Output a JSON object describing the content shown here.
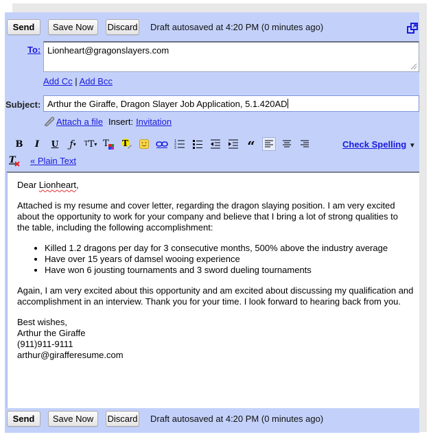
{
  "top_bar": {
    "send_label": "Send",
    "save_label": "Save Now",
    "discard_label": "Discard",
    "autosave_status": "Draft autosaved at 4:20 PM (0 minutes ago)",
    "popout_icon": "popout-window-icon"
  },
  "to": {
    "label": "To:",
    "value": "Lionheart@gragonslayers.com"
  },
  "cc_links": {
    "add_cc": "Add Cc",
    "separator": "|",
    "add_bcc": "Add Bcc"
  },
  "subject": {
    "label": "Subject:",
    "value": "Arthur the Giraffe, Dragon Slayer Job Application, 5.1.420AD"
  },
  "attach": {
    "icon": "paperclip-icon",
    "attach_label": "Attach a file",
    "insert_label": "Insert:",
    "invitation_label": "Invitation"
  },
  "toolbar": {
    "buttons": [
      {
        "name": "bold",
        "glyph": "B"
      },
      {
        "name": "italic",
        "glyph": "I"
      },
      {
        "name": "underline",
        "glyph": "U"
      },
      {
        "name": "font",
        "glyph": "ƒ·"
      },
      {
        "name": "font-size",
        "glyph": "тT·"
      },
      {
        "name": "text-color",
        "glyph": "T"
      },
      {
        "name": "highlight-color",
        "glyph": "T"
      },
      {
        "name": "emoticon",
        "glyph": "☺"
      },
      {
        "name": "link",
        "glyph": "∞"
      },
      {
        "name": "numbered-list",
        "glyph": "☰"
      },
      {
        "name": "bulleted-list",
        "glyph": "☰"
      },
      {
        "name": "indent-less",
        "glyph": "☰"
      },
      {
        "name": "indent-more",
        "glyph": "☰"
      },
      {
        "name": "quote",
        "glyph": "“"
      },
      {
        "name": "align-left",
        "glyph": "≡"
      },
      {
        "name": "align-center",
        "glyph": "≡"
      },
      {
        "name": "align-right",
        "glyph": "≡"
      }
    ],
    "active": "align-left",
    "check_spelling": "Check Spelling",
    "check_spelling_arrow": "▼",
    "remove_formatting_icon": "remove-formatting-icon",
    "plain_text_link": "« Plain Text"
  },
  "body": {
    "greeting_prefix": "Dear ",
    "greeting_name": "Lionheart",
    "greeting_suffix": ",",
    "paragraph1": "Attached is my resume and cover letter, regarding the dragon slaying position.  I am very excited about the opportunity to work for your company and believe that I bring a lot of strong qualities to the table, including the following accomplishment:",
    "bullets": [
      "Killed 1.2 dragons per day for 3 consecutive months, 500% above the industry average",
      "Have over 15 years of damsel wooing experience",
      "Have won 6 jousting tournaments and 3 sword dueling tournaments"
    ],
    "paragraph2": "Again, I am very excited about this opportunity and am excited about discussing my qualification and accomplishment in an interview.  Thank you for your time.  I look forward to hearing back from you.",
    "signature": [
      "Best wishes,",
      "Arthur the Giraffe",
      "(911)911-9111",
      "arthur@girafferesume.com"
    ]
  },
  "bottom_bar": {
    "send_label": "Send",
    "save_label": "Save Now",
    "discard_label": "Discard",
    "autosave_status": "Draft autosaved at 4:20 PM (0 minutes ago)"
  },
  "colors": {
    "panel": "#c3d1fa",
    "link": "#1a1adc",
    "frame": "#e8e8e8"
  }
}
